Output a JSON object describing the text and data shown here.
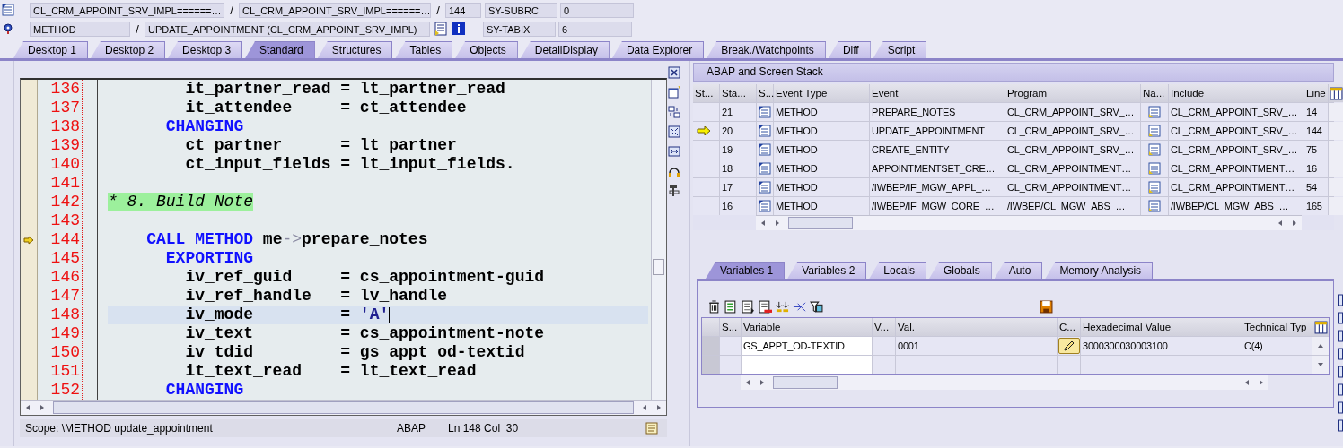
{
  "header": {
    "row1": {
      "include": "CL_CRM_APPOINT_SRV_IMPL======…",
      "program": "CL_CRM_APPOINT_SRV_IMPL======…",
      "line": "144",
      "var_name": "SY-SUBRC",
      "var_value": "0"
    },
    "row2": {
      "event_type": "METHOD",
      "event": "UPDATE_APPOINTMENT (CL_CRM_APPOINT_SRV_IMPL)",
      "var_name": "SY-TABIX",
      "var_value": "6"
    },
    "separator": "/"
  },
  "tabs": [
    {
      "label": "Desktop 1",
      "selected": false
    },
    {
      "label": "Desktop 2",
      "selected": false
    },
    {
      "label": "Desktop 3",
      "selected": false
    },
    {
      "label": "Standard",
      "selected": true
    },
    {
      "label": "Structures",
      "selected": false
    },
    {
      "label": "Tables",
      "selected": false
    },
    {
      "label": "Objects",
      "selected": false
    },
    {
      "label": "DetailDisplay",
      "selected": false
    },
    {
      "label": "Data Explorer",
      "selected": false
    },
    {
      "label": "Break./Watchpoints",
      "selected": false
    },
    {
      "label": "Diff",
      "selected": false
    },
    {
      "label": "Script",
      "selected": false
    }
  ],
  "editor": {
    "lines": [
      {
        "num": "136",
        "current": false,
        "cursor": false,
        "kind": "param",
        "tokens": [
          {
            "kind": "id",
            "t": "it_partner_read = lt_partner_read"
          }
        ]
      },
      {
        "num": "137",
        "current": false,
        "cursor": false,
        "kind": "param",
        "tokens": [
          {
            "kind": "id",
            "t": "it_attendee     = ct_attendee"
          }
        ]
      },
      {
        "num": "138",
        "current": false,
        "cursor": false,
        "kind": "keyword",
        "tokens": [
          {
            "kind": "kw",
            "t": "CHANGING"
          }
        ]
      },
      {
        "num": "139",
        "current": false,
        "cursor": false,
        "kind": "param",
        "tokens": [
          {
            "kind": "id",
            "t": "ct_partner      = lt_partner"
          }
        ]
      },
      {
        "num": "140",
        "current": false,
        "cursor": false,
        "kind": "param",
        "tokens": [
          {
            "kind": "id",
            "t": "ct_input_fields = lt_input_fields."
          }
        ]
      },
      {
        "num": "141",
        "current": false,
        "cursor": false,
        "kind": "blank"
      },
      {
        "num": "142",
        "current": false,
        "cursor": false,
        "kind": "comment",
        "tokens": [
          {
            "kind": "cm",
            "t": "* 8. Build Note"
          }
        ]
      },
      {
        "num": "143",
        "current": false,
        "cursor": false,
        "kind": "blank"
      },
      {
        "num": "144",
        "current": true,
        "cursor": false,
        "kind": "call",
        "tokens": [
          {
            "kind": "kw",
            "t": "CALL METHOD"
          },
          {
            "kind": "id",
            "t": " me"
          },
          {
            "kind": "op",
            "t": "->"
          },
          {
            "kind": "id",
            "t": "prepare_notes"
          }
        ]
      },
      {
        "num": "145",
        "current": false,
        "cursor": false,
        "kind": "keyword",
        "tokens": [
          {
            "kind": "kw",
            "t": "EXPORTING"
          }
        ]
      },
      {
        "num": "146",
        "current": false,
        "cursor": false,
        "kind": "param",
        "tokens": [
          {
            "kind": "id",
            "t": "iv_ref_guid     = cs_appointment-guid"
          }
        ]
      },
      {
        "num": "147",
        "current": false,
        "cursor": false,
        "kind": "param",
        "tokens": [
          {
            "kind": "id",
            "t": "iv_ref_handle   = lv_handle"
          }
        ]
      },
      {
        "num": "148",
        "current": false,
        "cursor": true,
        "kind": "param",
        "tokens": [
          {
            "kind": "id",
            "t": "iv_mode         = "
          },
          {
            "kind": "str",
            "t": "'A'"
          }
        ]
      },
      {
        "num": "149",
        "current": false,
        "cursor": false,
        "kind": "param",
        "tokens": [
          {
            "kind": "id",
            "t": "iv_text         = cs_appointment-note"
          }
        ]
      },
      {
        "num": "150",
        "current": false,
        "cursor": false,
        "kind": "param",
        "tokens": [
          {
            "kind": "id",
            "t": "iv_tdid         = gs_appt_od-textid"
          }
        ]
      },
      {
        "num": "151",
        "current": false,
        "cursor": false,
        "kind": "param",
        "tokens": [
          {
            "kind": "id",
            "t": "it_text_read    = lt_text_read"
          }
        ]
      },
      {
        "num": "152",
        "current": false,
        "cursor": false,
        "kind": "keyword",
        "tokens": [
          {
            "kind": "kw",
            "t": "CHANGING"
          }
        ]
      }
    ],
    "status": {
      "scope": "Scope: \\METHOD update_appointment",
      "language": "ABAP",
      "position": "Ln 148 Col  30"
    }
  },
  "stack": {
    "title": "ABAP and Screen Stack",
    "columns": [
      "St...",
      "Sta...",
      "S...",
      "Event Type",
      "Event",
      "Program",
      "Na...",
      "Include",
      "Line"
    ],
    "rows": [
      {
        "current": false,
        "level": "21",
        "event_type": "METHOD",
        "event": "PREPARE_NOTES",
        "program": "CL_CRM_APPOINT_SRV_…",
        "include": "CL_CRM_APPOINT_SRV_…",
        "line": "14"
      },
      {
        "current": true,
        "level": "20",
        "event_type": "METHOD",
        "event": "UPDATE_APPOINTMENT",
        "program": "CL_CRM_APPOINT_SRV_…",
        "include": "CL_CRM_APPOINT_SRV_…",
        "line": "144"
      },
      {
        "current": false,
        "level": "19",
        "event_type": "METHOD",
        "event": "CREATE_ENTITY",
        "program": "CL_CRM_APPOINT_SRV_…",
        "include": "CL_CRM_APPOINT_SRV_…",
        "line": "75"
      },
      {
        "current": false,
        "level": "18",
        "event_type": "METHOD",
        "event": "APPOINTMENTSET_CRE…",
        "program": "CL_CRM_APPOINTMENT…",
        "include": "CL_CRM_APPOINTMENT…",
        "line": "16"
      },
      {
        "current": false,
        "level": "17",
        "event_type": "METHOD",
        "event": "/IWBEP/IF_MGW_APPL_…",
        "program": "CL_CRM_APPOINTMENT…",
        "include": "CL_CRM_APPOINTMENT…",
        "line": "54"
      },
      {
        "current": false,
        "level": "16",
        "event_type": "METHOD",
        "event": "/IWBEP/IF_MGW_CORE_…",
        "program": "/IWBEP/CL_MGW_ABS_…",
        "include": "/IWBEP/CL_MGW_ABS_…",
        "line": "165"
      }
    ]
  },
  "var_tabs": [
    {
      "label": "Variables 1",
      "selected": true
    },
    {
      "label": "Variables 2",
      "selected": false
    },
    {
      "label": "Locals",
      "selected": false
    },
    {
      "label": "Globals",
      "selected": false
    },
    {
      "label": "Auto",
      "selected": false
    },
    {
      "label": "Memory Analysis",
      "selected": false
    }
  ],
  "variables": {
    "columns": [
      "S...",
      "Variable",
      "V...",
      "Val.",
      "C...",
      "Hexadecimal Value",
      "Technical Typ"
    ],
    "rows": [
      {
        "variable": "GS_APPT_OD-TEXTID",
        "value": "0001",
        "hex": "3000300030003100",
        "type": "C(4)"
      }
    ]
  }
}
